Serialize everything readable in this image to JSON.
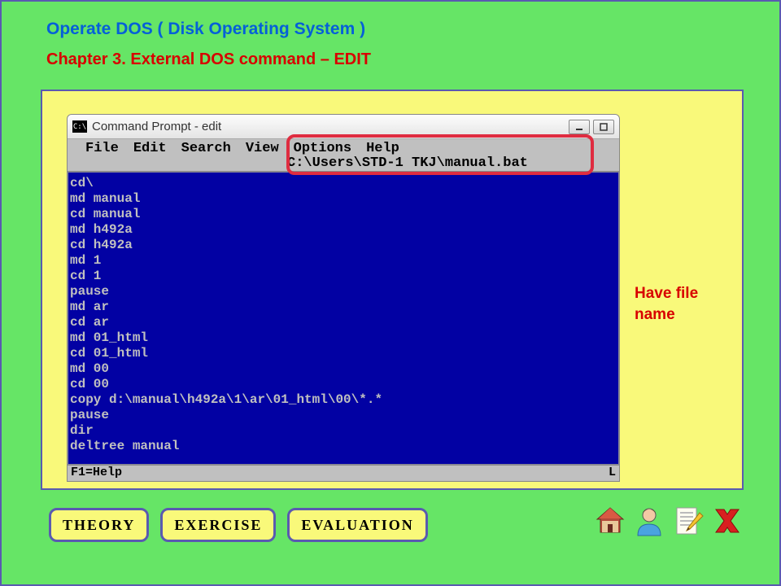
{
  "title": "Operate DOS ( Disk Operating System )",
  "chapter": "Chapter 3.    External DOS command – EDIT",
  "cmd": {
    "windowTitle": "Command Prompt - edit",
    "menus": {
      "file": "File",
      "edit": "Edit",
      "search": "Search",
      "view": "View",
      "options": "Options",
      "help": "Help"
    },
    "filepath": "C:\\Users\\STD-1 TKJ\\manual.bat",
    "content": "cd\\\nmd manual\ncd manual\nmd h492a\ncd h492a\nmd 1\ncd 1\npause\nmd ar\ncd ar\nmd 01_html\ncd 01_html\nmd 00\ncd 00\ncopy d:\\manual\\h492a\\1\\ar\\01_html\\00\\*.*\npause\ndir\ndeltree manual",
    "statusLeft": "F1=Help",
    "statusRight": "L"
  },
  "annotation": "Have file name",
  "buttons": {
    "theory": "Theory",
    "exercise": "Exercise",
    "evaluation": "Evaluation"
  }
}
